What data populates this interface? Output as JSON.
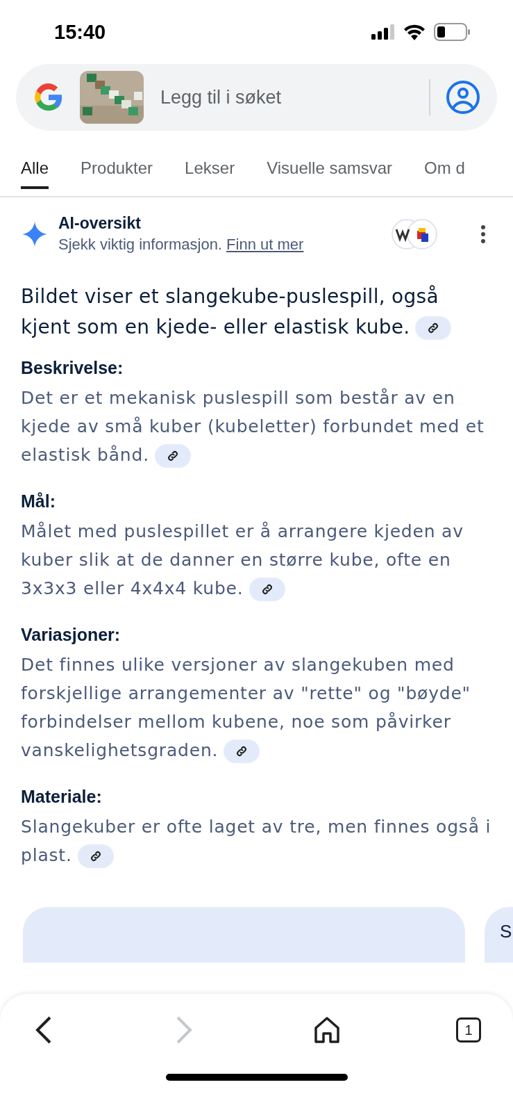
{
  "status_bar": {
    "time": "15:40"
  },
  "search": {
    "placeholder": "Legg til i søket"
  },
  "tabs": [
    {
      "label": "Alle",
      "selected": true
    },
    {
      "label": "Produkter",
      "selected": false
    },
    {
      "label": "Lekser",
      "selected": false
    },
    {
      "label": "Visuelle samsvar",
      "selected": false
    },
    {
      "label": "Om d",
      "selected": false
    }
  ],
  "ai_overview": {
    "title": "AI-oversikt",
    "subtitle": "Sjekk viktig informasjon.",
    "link": "Finn ut mer",
    "summary": "Bildet viser et slangekube-puslespill, også kjent som en kjede- eller elastisk kube.",
    "sections": [
      {
        "heading": "Beskrivelse:",
        "body": "Det er et mekanisk puslespill som består av en kjede av små kuber (kubeletter) forbundet med et elastisk bånd."
      },
      {
        "heading": "Mål:",
        "body": "Målet med puslespillet er å arrangere kjeden av kuber slik at de danner en større kube, ofte en 3x3x3 eller 4x4x4 kube."
      },
      {
        "heading": "Variasjoner:",
        "body": "Det finnes ulike versjoner av slangekuben med forskjellige arrangementer av \"rette\" og \"bøyde\" forbindelser mellom kubene, noe som påvirker vanskelighetsgraden."
      },
      {
        "heading": "Materiale:",
        "body": "Slangekuber er ofte laget av tre, men finnes også i plast."
      }
    ]
  },
  "next_card": {
    "text": "S"
  },
  "nav": [
    {
      "kind": "back",
      "disabled": false
    },
    {
      "kind": "forward",
      "disabled": true
    },
    {
      "kind": "home",
      "disabled": false
    },
    {
      "kind": "tabs",
      "disabled": false,
      "count": "1"
    }
  ]
}
